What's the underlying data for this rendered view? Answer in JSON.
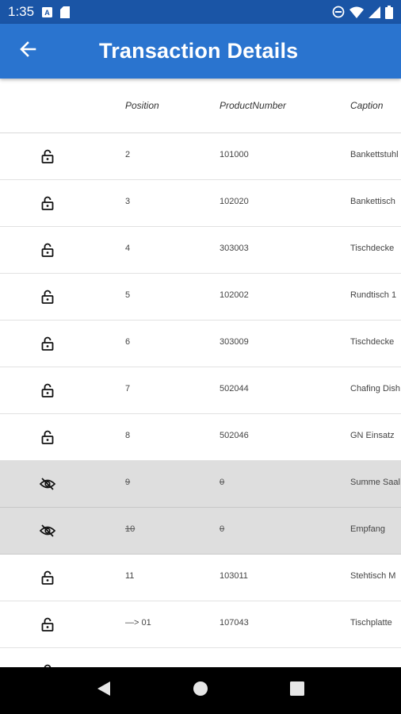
{
  "status_bar": {
    "time": "1:35",
    "left_icons": [
      "a-box-icon",
      "sd-card-icon"
    ],
    "right_icons": [
      "do-not-disturb-icon",
      "wifi-icon",
      "signal-icon",
      "battery-icon"
    ]
  },
  "app_bar": {
    "title": "Transaction Details",
    "back_icon": "arrow-left-icon",
    "color": "#2a74cf",
    "status_color": "#1a55a6"
  },
  "table": {
    "columns": [
      "",
      "Position",
      "ProductNumber",
      "Caption"
    ],
    "rows": [
      {
        "icon": "lock-open-icon",
        "position": "2",
        "product_number": "101000",
        "caption": "Bankettstuhl",
        "hidden": false
      },
      {
        "icon": "lock-open-icon",
        "position": "3",
        "product_number": "102020",
        "caption": "Bankettisch",
        "hidden": false
      },
      {
        "icon": "lock-open-icon",
        "position": "4",
        "product_number": "303003",
        "caption": "Tischdecke",
        "hidden": false
      },
      {
        "icon": "lock-open-icon",
        "position": "5",
        "product_number": "102002",
        "caption": "Rundtisch 1",
        "hidden": false
      },
      {
        "icon": "lock-open-icon",
        "position": "6",
        "product_number": "303009",
        "caption": "Tischdecke",
        "hidden": false
      },
      {
        "icon": "lock-open-icon",
        "position": "7",
        "product_number": "502044",
        "caption": "Chafing Dish",
        "hidden": false
      },
      {
        "icon": "lock-open-icon",
        "position": "8",
        "product_number": "502046",
        "caption": "GN Einsatz",
        "hidden": false
      },
      {
        "icon": "eye-off-icon",
        "position": "9",
        "product_number": "0",
        "caption": "Summe Saal",
        "hidden": true
      },
      {
        "icon": "eye-off-icon",
        "position": "10",
        "product_number": "0",
        "caption": "Empfang",
        "hidden": true
      },
      {
        "icon": "lock-open-icon",
        "position": "11",
        "product_number": "103011",
        "caption": "Stehtisch M",
        "hidden": false
      },
      {
        "icon": "lock-open-icon",
        "position": "—> 01",
        "product_number": "107043",
        "caption": "Tischplatte",
        "hidden": false
      },
      {
        "icon": "lock-open-icon",
        "position": "",
        "product_number": "",
        "caption": "",
        "hidden": false
      }
    ]
  },
  "nav_bar": {
    "buttons": [
      "back-triangle-icon",
      "home-circle-icon",
      "recents-square-icon"
    ]
  }
}
